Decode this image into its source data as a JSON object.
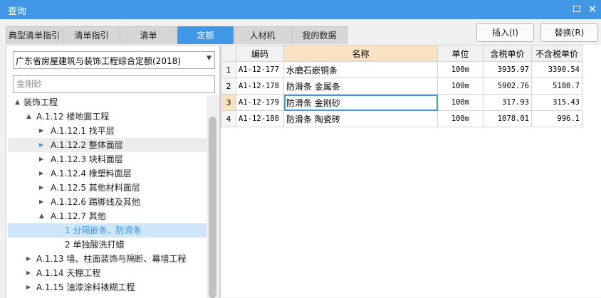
{
  "window": {
    "title": "查询"
  },
  "tabs": [
    {
      "label": "典型清单指引",
      "active": false
    },
    {
      "label": "清单指引",
      "active": false
    },
    {
      "label": "清单",
      "active": false
    },
    {
      "label": "定额",
      "active": true
    },
    {
      "label": "人材机",
      "active": false
    },
    {
      "label": "我的数据",
      "active": false
    }
  ],
  "buttons": {
    "insert": "插入(I)",
    "replace": "替换(R)"
  },
  "left": {
    "quota_library": "广东省房屋建筑与装饰工程综合定额(2018)",
    "search_value": "金刚砂"
  },
  "tree": [
    {
      "label": "装饰工程",
      "arrow": "▲",
      "level": 0
    },
    {
      "label": "A.1.12 楼地面工程",
      "arrow": "▲",
      "level": 1
    },
    {
      "label": "A.1.12.1 找平层",
      "arrow": "▶",
      "level": 2
    },
    {
      "label": "A.1.12.2 整体面层",
      "arrow": "▶",
      "level": 2
    },
    {
      "label": "A.1.12.3 块料面层",
      "arrow": "▶",
      "level": 2
    },
    {
      "label": "A.1.12.4 橡塑料面层",
      "arrow": "▶",
      "level": 2
    },
    {
      "label": "A.1.12.5 其他材料面层",
      "arrow": "▶",
      "level": 2
    },
    {
      "label": "A.1.12.6 踢脚线及其他",
      "arrow": "▶",
      "level": 2
    },
    {
      "label": "A.1.12.7 其他",
      "arrow": "▲",
      "level": 2
    },
    {
      "label": "1 分隔嵌条、防滑条",
      "arrow": "",
      "level": 3
    },
    {
      "label": "2 单独酸洗打蜡",
      "arrow": "",
      "level": 3
    },
    {
      "label": "A.1.13 墙、柱面装饰与隔断、幕墙工程",
      "arrow": "▶",
      "level": 1
    },
    {
      "label": "A.1.14 天棚工程",
      "arrow": "▶",
      "level": 1
    },
    {
      "label": "A.1.15 油漆涂料裱糊工程",
      "arrow": "▶",
      "level": 1
    }
  ],
  "table": {
    "headers": [
      "",
      "编码",
      "名称",
      "单位",
      "含税单价",
      "不含税单价"
    ],
    "rows": [
      [
        "1",
        "A1-12-177",
        "水磨石嵌铜条",
        "100m",
        "3935.97",
        "3390.54"
      ],
      [
        "2",
        "A1-12-178",
        "防滑条 金属条",
        "100m",
        "5902.76",
        "5180.7"
      ],
      [
        "3",
        "A1-12-179",
        "防滑条 金刚砂",
        "100m",
        "317.93",
        "315.43"
      ],
      [
        "4",
        "A1-12-180",
        "防滑条 陶瓷砖",
        "100m",
        "1078.01",
        "996.1"
      ]
    ]
  },
  "colors": {
    "accent": "#3f97e6",
    "header_highlight": "#f9e1c3",
    "tree_selected": "#cfe6fa"
  }
}
